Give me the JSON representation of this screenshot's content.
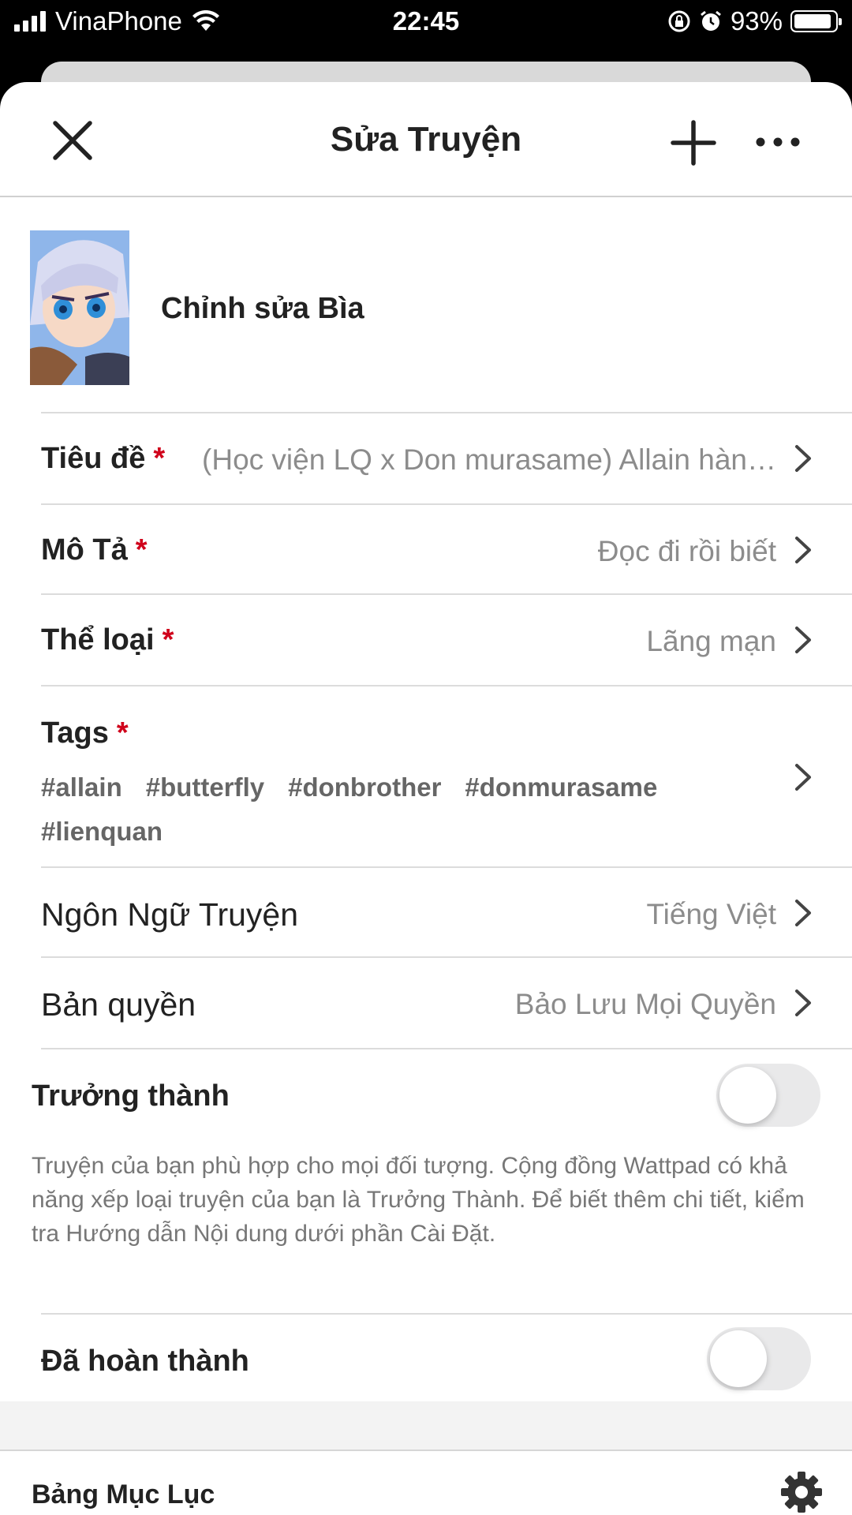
{
  "status_bar": {
    "carrier": "VinaPhone",
    "time": "22:45",
    "battery": "93%",
    "battery_level": 0.93
  },
  "header": {
    "title": "Sửa Truyện",
    "close_icon": "close-icon",
    "add_icon": "plus-icon",
    "more_icon": "more-icon"
  },
  "cover": {
    "label": "Chỉnh sửa Bìa"
  },
  "fields": {
    "title": {
      "label": "Tiêu đề",
      "required": "*",
      "value": "(Học viện LQ x Don murasame) Allain hàn…"
    },
    "description": {
      "label": "Mô Tả",
      "required": "*",
      "value": "Đọc đi rồi biết"
    },
    "genre": {
      "label": "Thể loại",
      "required": "*",
      "value": "Lãng mạn"
    },
    "tags": {
      "label": "Tags",
      "required": "*",
      "items": [
        "#allain",
        "#butterfly",
        "#donbrother",
        "#donmurasame",
        "#lienquan"
      ]
    },
    "language": {
      "label": "Ngôn Ngữ Truyện",
      "value": "Tiếng Việt"
    },
    "copyright": {
      "label": "Bản quyền",
      "value": "Bảo Lưu Mọi Quyền"
    }
  },
  "mature": {
    "label": "Trưởng thành",
    "enabled": false,
    "description": "Truyện của bạn phù hợp cho mọi đối tượng. Cộng đồng Wattpad có khả năng xếp loại truyện của bạn là Trưởng Thành. Để biết thêm chi tiết, kiểm tra Hướng dẫn Nội dung dưới phần Cài Đặt."
  },
  "completed": {
    "label": "Đã hoàn thành",
    "enabled": false
  },
  "toc": {
    "label": "Bảng Mục Lục",
    "icon": "gear-icon"
  },
  "colors": {
    "required": "#d0021b",
    "toggle_off": "#e9e9ea",
    "value_text": "#8c8c8c"
  }
}
